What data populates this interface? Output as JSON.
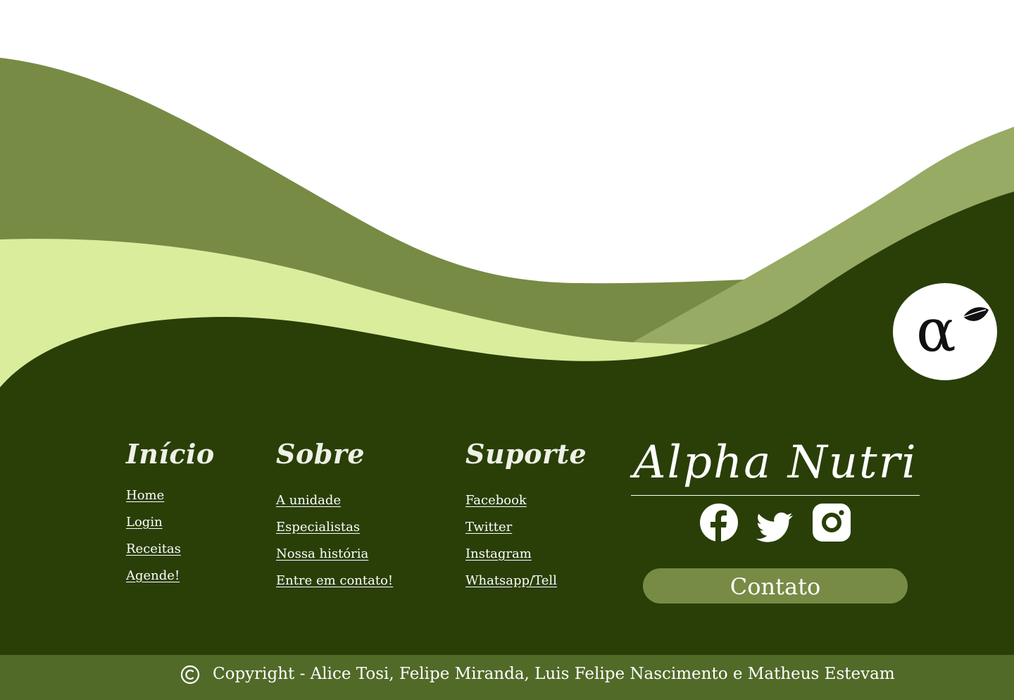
{
  "colors": {
    "dark_green": "#2a3f07",
    "olive": "#778b45",
    "light_olive": "#97ab65",
    "pale_green": "#d9ed9d",
    "footer_bar": "#516a28",
    "white": "#ffffff"
  },
  "logo": {
    "icon": "alpha-leaf-logo"
  },
  "columns": {
    "inicio": {
      "title": "Início",
      "links": [
        "Home",
        "Login",
        "Receitas",
        "Agende!"
      ]
    },
    "sobre": {
      "title": "Sobre",
      "links": [
        "A unidade",
        "Especialistas",
        "Nossa história",
        "Entre em contato!"
      ]
    },
    "suporte": {
      "title": "Suporte",
      "links": [
        "Facebook",
        "Twitter",
        "Instagram",
        "Whatsapp/Tell"
      ]
    }
  },
  "brand": {
    "name": "Alpha Nutri",
    "social_icons": [
      "facebook-icon",
      "twitter-icon",
      "instagram-icon"
    ],
    "contact_label": "Contato"
  },
  "footer": {
    "copyright_icon": "copyright-icon",
    "text": "Copyright - Alice Tosi, Felipe Miranda, Luis Felipe Nascimento e Matheus Estevam"
  }
}
